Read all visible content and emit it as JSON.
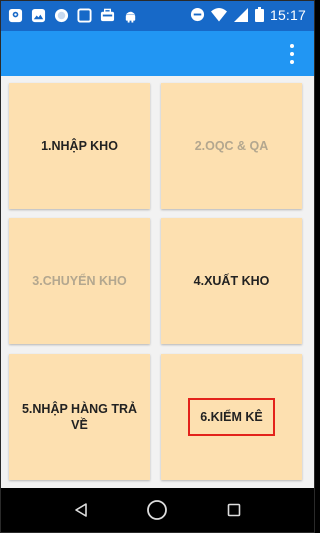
{
  "status_bar": {
    "time": "15:17",
    "icons_left": [
      "location-icon",
      "image-icon",
      "circle-icon",
      "square-icon",
      "briefcase-icon",
      "android-icon"
    ],
    "icons_right": [
      "do-not-disturb-icon",
      "wifi-icon",
      "signal-icon",
      "battery-icon"
    ]
  },
  "app_bar": {
    "menu_icon": "more-vert-icon",
    "color": "#2196f3"
  },
  "tiles": [
    {
      "label": "1.NHẬP KHO",
      "enabled": true
    },
    {
      "label": "2.OQC & QA",
      "enabled": false
    },
    {
      "label": "3.CHUYỂN KHO",
      "enabled": false
    },
    {
      "label": "4.XUẤT KHO",
      "enabled": true
    },
    {
      "label": "5.NHẬP HÀNG TRẢ VỀ",
      "enabled": true
    },
    {
      "label": "6.KIỂM KÊ",
      "enabled": true,
      "highlighted": true
    }
  ],
  "colors": {
    "tile_bg": "#fde0b0",
    "status_bar": "#1769c8",
    "highlight_border": "#e3231b",
    "disabled_text": "#b3a78f"
  },
  "nav_bar": {
    "icons": [
      "back-icon",
      "home-icon",
      "recents-icon"
    ]
  }
}
